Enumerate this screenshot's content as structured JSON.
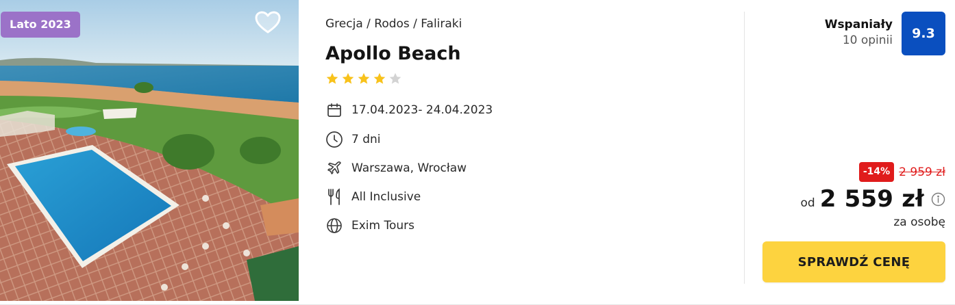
{
  "photo": {
    "badge": "Lato 2023",
    "favorite_icon": "heart-outline-icon"
  },
  "hotel": {
    "breadcrumb": "Grecja / Rodos / Faliraki",
    "name": "Apollo Beach",
    "stars": {
      "filled": 4,
      "total": 5
    },
    "features": [
      {
        "icon": "calendar-icon",
        "text": "17.04.2023- 24.04.2023"
      },
      {
        "icon": "clock-icon",
        "text": "7 dni"
      },
      {
        "icon": "plane-icon",
        "text": "Warszawa, Wrocław"
      },
      {
        "icon": "cutlery-icon",
        "text": "All Inclusive"
      },
      {
        "icon": "globe-icon",
        "text": "Exim Tours"
      }
    ]
  },
  "rating": {
    "label": "Wspaniały",
    "count": "10 opinii",
    "score": "9.3"
  },
  "price": {
    "discount": "-14%",
    "old": "2 959 zł",
    "prefix": "od",
    "current": "2 559 zł",
    "per": "za osobę"
  },
  "cta": {
    "label": "SPRAWDŹ CENĘ"
  },
  "colors": {
    "badge": "#9b72c8",
    "score": "#0a4fbf",
    "discount": "#e01c1c",
    "cta": "#fdd33f",
    "star": "#f8c21b"
  }
}
